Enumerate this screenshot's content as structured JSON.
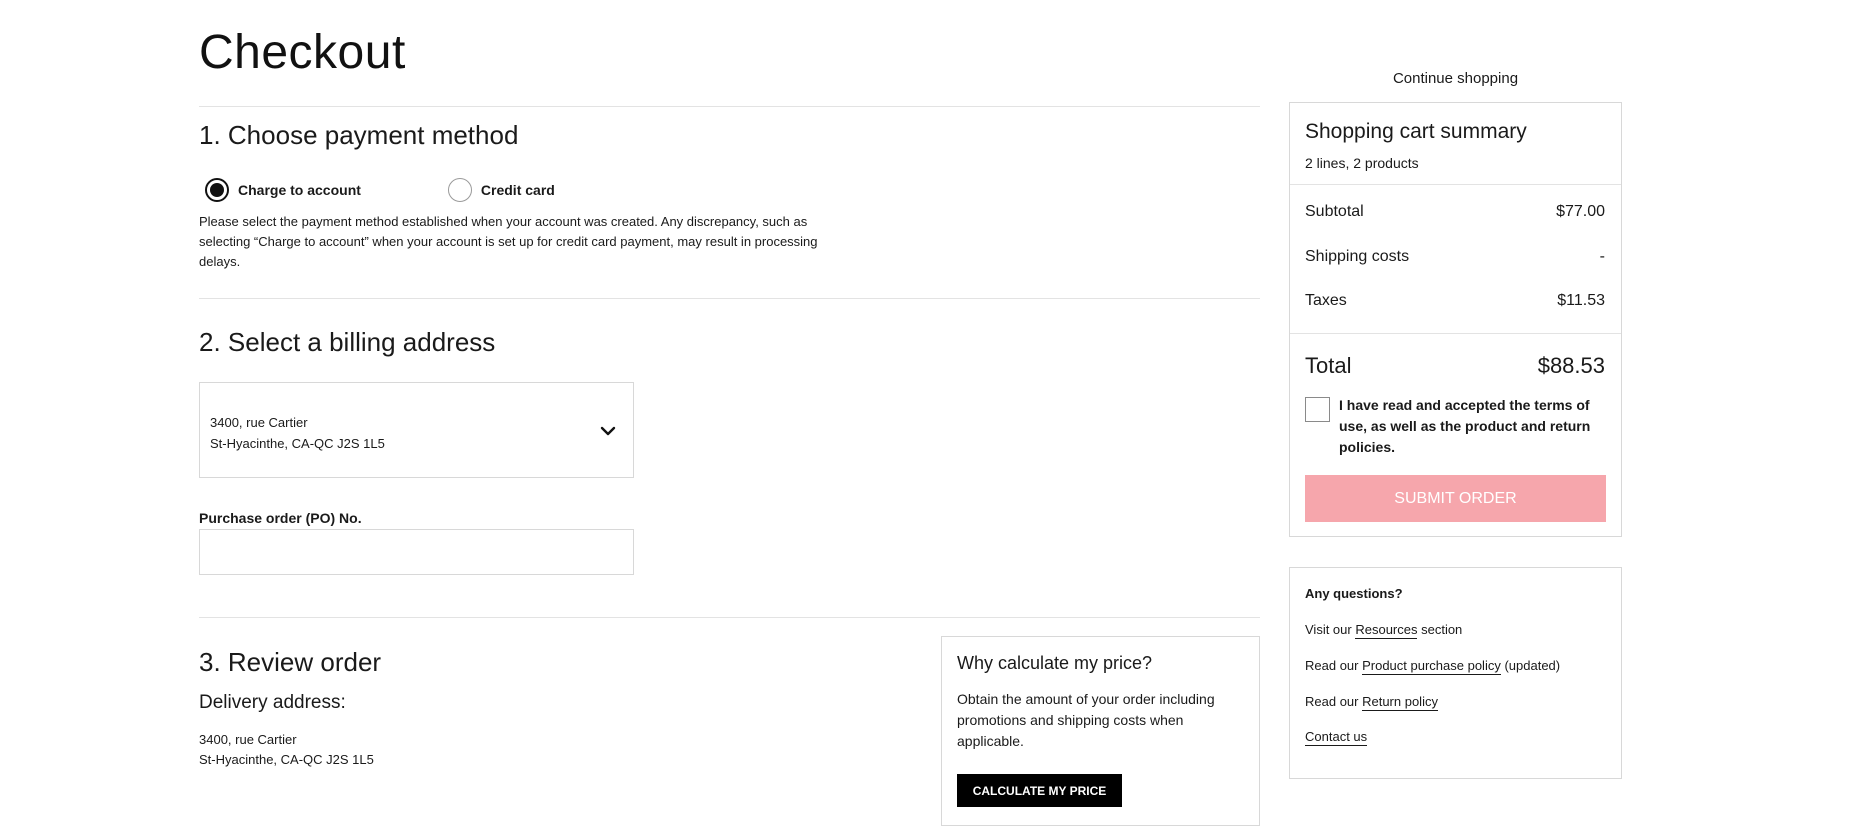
{
  "page": {
    "title": "Checkout"
  },
  "payment": {
    "section_title": "1. Choose payment method",
    "options": [
      {
        "label": "Charge to account",
        "selected": true
      },
      {
        "label": "Credit card",
        "selected": false
      }
    ],
    "note": "Please select the payment method established when your account was created. Any discrepancy, such as selecting “Charge to account” when your account is set up for credit card payment, may result in processing delays."
  },
  "billing": {
    "section_title": "2. Select a billing address",
    "address_line1": "3400, rue Cartier",
    "address_line2": "St-Hyacinthe, CA-QC J2S 1L5",
    "po_label": "Purchase order (PO) No.",
    "po_value": ""
  },
  "review": {
    "section_title": "3. Review order",
    "delivery_title": "Delivery address:",
    "delivery_line1": "3400, rue Cartier",
    "delivery_line2": "St-Hyacinthe, CA-QC J2S 1L5"
  },
  "why": {
    "title": "Why calculate my price?",
    "text": "Obtain the amount of your order including promotions and shipping costs when applicable.",
    "button_label": "CALCULATE MY PRICE"
  },
  "sidebar": {
    "continue_label": "Continue shopping",
    "summary": {
      "title": "Shopping cart summary",
      "subtitle": "2 lines, 2 products",
      "subtotal_label": "Subtotal",
      "subtotal_value": "$77.00",
      "shipping_label": "Shipping costs",
      "shipping_value": "-",
      "taxes_label": "Taxes",
      "taxes_value": "$11.53",
      "total_label": "Total",
      "total_value": "$88.53",
      "terms_text": "I have read and accepted the terms of use, as well as the product and return policies.",
      "submit_label": "SUBMIT ORDER",
      "submit_color": "#f6a6ac"
    },
    "questions": {
      "title": "Any questions?",
      "resources_prefix": "Visit our ",
      "resources_link": "Resources",
      "resources_suffix": " section",
      "policy_prefix": "Read our ",
      "policy_link": "Product purchase policy",
      "policy_suffix": " (updated)",
      "return_prefix": "Read our ",
      "return_link": "Return policy",
      "contact_link": "Contact us"
    }
  }
}
